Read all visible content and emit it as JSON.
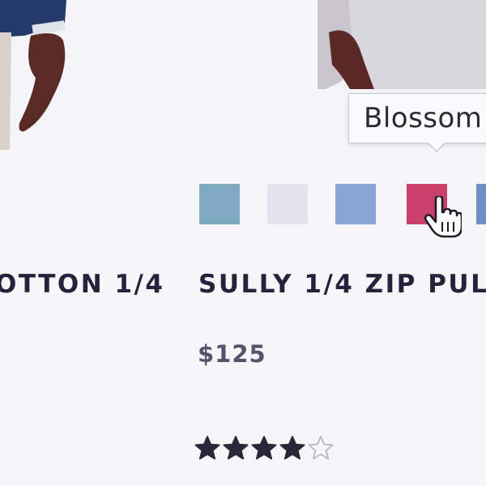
{
  "products": [
    {
      "title": "OTTON 1/4"
    },
    {
      "title": "SULLY 1/4 ZIP PUL",
      "price": "$125",
      "rating": {
        "value": 4,
        "max": 5
      },
      "tooltip": "Blossom",
      "swatches": [
        {
          "color": "#7fa9c0"
        },
        {
          "color": "#e4e4ee"
        },
        {
          "color": "#8aa6d6"
        },
        {
          "color": "#c9416a"
        },
        {
          "color": "#6f8fc4"
        }
      ],
      "hovered_swatch": 3
    }
  ],
  "icons": {
    "cursor": "hand-pointer-icon",
    "star_filled": "star-filled-icon",
    "star_empty": "star-outline-icon"
  },
  "colors": {
    "title": "#25233b",
    "price": "#56536b",
    "star": "#2a2838"
  }
}
